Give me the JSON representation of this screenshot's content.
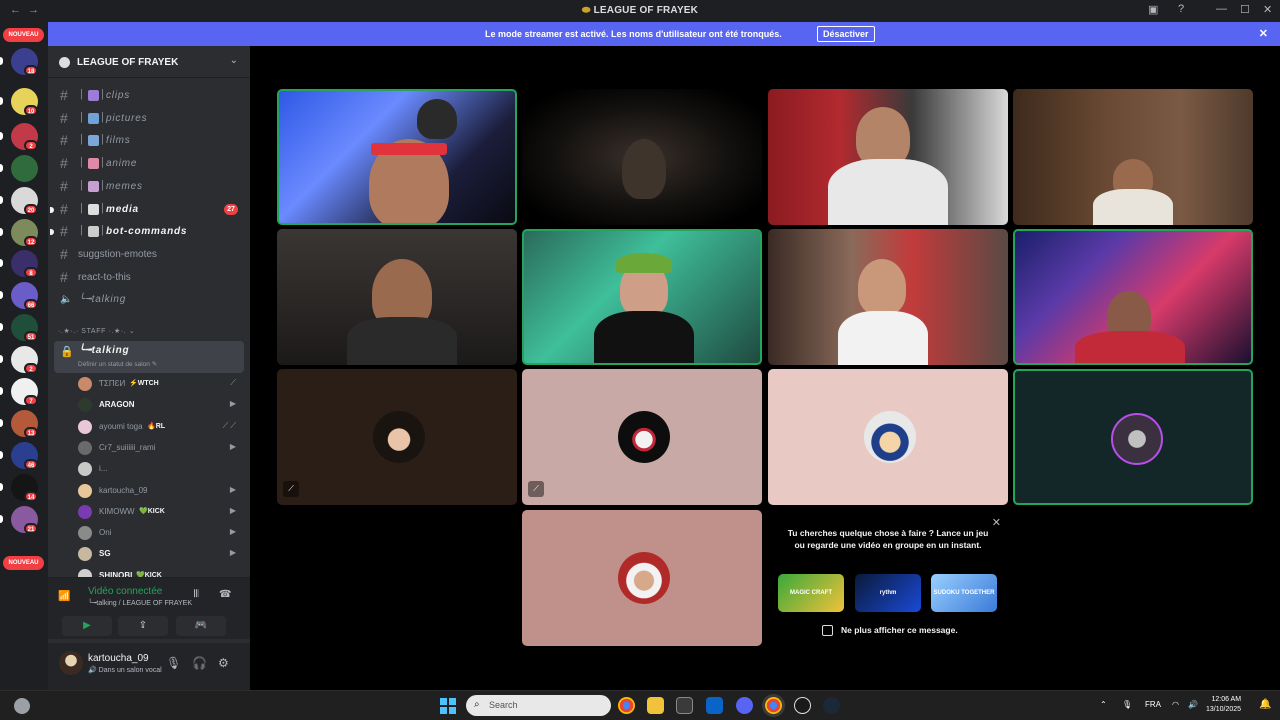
{
  "window": {
    "title": "LEAGUE OF FRAYEK",
    "back": "←",
    "forward": "→"
  },
  "banner": {
    "text": "Le mode streamer est activé. Les noms d'utilisateur ont été tronqués.",
    "button": "Désactiver",
    "close": "✕"
  },
  "servers": {
    "new_label_top": "NOUVEAU",
    "new_label_bottom": "NOUVEAU",
    "items": [
      {
        "badge": "18",
        "color": "#3b3f8f"
      },
      {
        "badge": "10",
        "color": "#e8d35a"
      },
      {
        "badge": "2",
        "color": "#c23a4a"
      },
      {
        "badge": "",
        "color": "#2f6b3c"
      },
      {
        "badge": "20",
        "color": "#d9d9d9"
      },
      {
        "badge": "12",
        "color": "#7c8a5c"
      },
      {
        "badge": "8",
        "color": "#3a2f6b"
      },
      {
        "badge": "66",
        "color": "#6a5cc9"
      },
      {
        "badge": "51",
        "color": "#1f4f3a"
      },
      {
        "badge": "2",
        "color": "#e8e8e8"
      },
      {
        "badge": "7",
        "color": "#f0f0f0"
      },
      {
        "badge": "13",
        "color": "#b45a3a"
      },
      {
        "badge": "46",
        "color": "#2a3f8f"
      },
      {
        "badge": "14",
        "color": "#151515"
      },
      {
        "badge": "21",
        "color": "#8a5aa0"
      }
    ]
  },
  "guild": {
    "name": "LEAGUE OF FRAYEK",
    "chevron": "⌄"
  },
  "channels": [
    {
      "label": "clips",
      "type": "text",
      "emoji_color": "#9b7cd6",
      "unread": false,
      "badge": ""
    },
    {
      "label": "pictures",
      "type": "text",
      "emoji_color": "#6fa3d8",
      "unread": false,
      "badge": ""
    },
    {
      "label": "films",
      "type": "text",
      "emoji_color": "#7da6d8",
      "unread": false,
      "badge": ""
    },
    {
      "label": "anime",
      "type": "text",
      "emoji_color": "#e08aa8",
      "unread": false,
      "badge": ""
    },
    {
      "label": "memes",
      "type": "text",
      "emoji_color": "#c5a0d0",
      "unread": false,
      "badge": ""
    },
    {
      "label": "media",
      "type": "text",
      "emoji_color": "#dddddd",
      "unread": true,
      "badge": "27"
    },
    {
      "label": "bot-commands",
      "type": "text",
      "emoji_color": "#cccccc",
      "unread": true,
      "badge": ""
    },
    {
      "label": "suggstion-emotes",
      "type": "text",
      "plain": true,
      "unread": false,
      "badge": ""
    },
    {
      "label": "react-to-this",
      "type": "text",
      "plain": true,
      "unread": false,
      "badge": ""
    },
    {
      "label": "╰╼talking",
      "type": "voice",
      "unread": false,
      "badge": ""
    }
  ],
  "staff_category": "·.★·.· STAFF ·.★·. ⌄",
  "active_voice": {
    "name": "╰╼talking",
    "status": "Définir un statut de salon ✎",
    "lock": "🔒"
  },
  "voice_users": [
    {
      "name": "ƬΣΠƐИ",
      "tag": "⚡WTCH",
      "highlight": false,
      "icons": "⟋",
      "color": "#c98a6a"
    },
    {
      "name": "ARAGON",
      "tag": "",
      "highlight": true,
      "icons": "▶",
      "color": "#2f3a2f"
    },
    {
      "name": "ayoumi toga",
      "tag": "🔥RL",
      "highlight": false,
      "icons": "⟋ ⟋",
      "color": "#e8c8d8"
    },
    {
      "name": "Cr7_suiiiiii_rami",
      "tag": "",
      "highlight": false,
      "icons": "▶",
      "color": "#6a6a6a"
    },
    {
      "name": "i...",
      "tag": "",
      "highlight": false,
      "icons": "",
      "color": "#c8c8c8"
    },
    {
      "name": "kartoucha_09",
      "tag": "",
      "highlight": false,
      "icons": "▶",
      "color": "#e8c89a"
    },
    {
      "name": "KIMOWW",
      "tag": "💚KICK",
      "highlight": false,
      "icons": "▶",
      "color": "#7a3ab0"
    },
    {
      "name": "Oni",
      "tag": "",
      "highlight": false,
      "icons": "▶",
      "color": "#8a8a8a"
    },
    {
      "name": "SG",
      "tag": "",
      "highlight": true,
      "icons": "▶",
      "color": "#c8b8a0"
    },
    {
      "name": "SHINOBI",
      "tag": "💚KICK",
      "highlight": true,
      "icons": "",
      "color": "#d0d0d0"
    }
  ],
  "voice_panel": {
    "status": "Vidéo connectée",
    "sub": "╰╼talking / LEAGUE OF FRAYEK",
    "buttons": [
      "▶",
      "⇪",
      "🎮",
      "✦"
    ]
  },
  "user": {
    "name": "kartoucha_09",
    "status": "🔊 Dans un salon vocal"
  },
  "activity": {
    "text": "Tu cherches quelque chose à faire ? Lance un jeu ou regarde une vidéo en groupe en un instant.",
    "close": "✕",
    "games": [
      "MAGIC CRAFT",
      "rythm",
      "SUDOKU TOGETHER"
    ],
    "checkbox_label": "Ne plus afficher ce message."
  },
  "taskbar": {
    "search": "Search",
    "lang": "FRA",
    "time": "12:06 AM",
    "date": "13/10/2025"
  }
}
